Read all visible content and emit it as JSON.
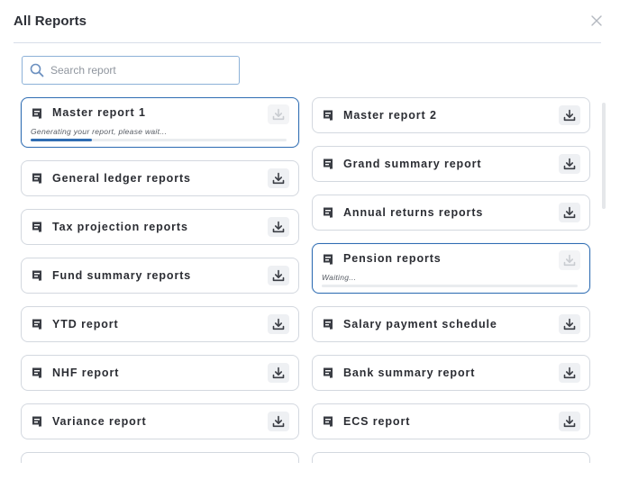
{
  "modal": {
    "title": "All Reports"
  },
  "search": {
    "placeholder": "Search report",
    "value": ""
  },
  "left_reports": [
    {
      "label": "Master report 1",
      "state": "generating",
      "status": "Generating your report, please wait...",
      "progress": 0.24
    },
    {
      "label": "General ledger reports",
      "state": "ready"
    },
    {
      "label": "Tax projection reports",
      "state": "ready"
    },
    {
      "label": "Fund summary reports",
      "state": "ready"
    },
    {
      "label": "YTD report",
      "state": "ready"
    },
    {
      "label": "NHF report",
      "state": "ready"
    },
    {
      "label": "Variance report",
      "state": "ready"
    }
  ],
  "right_reports": [
    {
      "label": "Master report 2",
      "state": "ready"
    },
    {
      "label": "Grand summary report",
      "state": "ready"
    },
    {
      "label": "Annual returns reports",
      "state": "ready"
    },
    {
      "label": "Pension reports",
      "state": "waiting",
      "status": "Waiting...",
      "progress": 0
    },
    {
      "label": "Salary payment schedule",
      "state": "ready"
    },
    {
      "label": "Bank summary report",
      "state": "ready"
    },
    {
      "label": "ECS report",
      "state": "ready"
    }
  ],
  "icons": {
    "report": "document-icon",
    "download": "download-icon",
    "search": "search-icon",
    "close": "close-icon"
  },
  "colors": {
    "accent": "#2f6db3",
    "border": "#d3d8df",
    "text": "#2b2d33"
  }
}
